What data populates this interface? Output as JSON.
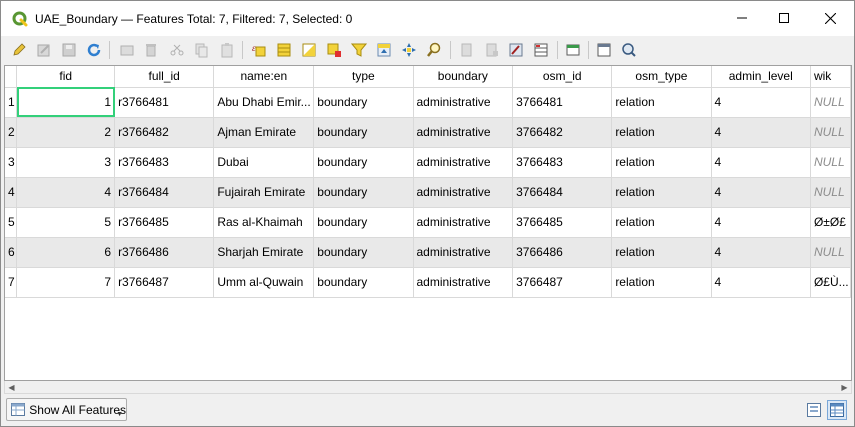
{
  "window": {
    "title": "UAE_Boundary — Features Total: 7, Filtered: 7, Selected: 0"
  },
  "toolbar_icons": [
    "toggle-editing-icon",
    "multi-edit-icon",
    "save-edits-icon",
    "reload-icon",
    "add-feature-icon",
    "delete-feature-icon",
    "cut-icon",
    "copy-icon",
    "paste-icon",
    "select-by-expression-icon",
    "select-all-icon",
    "invert-selection-icon",
    "deselect-all-icon",
    "filter-select-icon",
    "move-selection-top-icon",
    "pan-to-selection-icon",
    "zoom-to-selection-icon",
    "new-field-icon",
    "delete-field-icon",
    "open-field-calculator-icon",
    "conditional-formatting-icon",
    "dock-table-icon",
    "actions-icon",
    "zoom-map-icon"
  ],
  "table": {
    "columns": [
      "fid",
      "full_id",
      "name:en",
      "type",
      "boundary",
      "osm_id",
      "osm_type",
      "admin_level",
      "wik"
    ],
    "rows": [
      {
        "row": "1",
        "fid": "1",
        "full_id": "r3766481",
        "name_en": "Abu Dhabi Emir...",
        "type": "boundary",
        "boundary": "administrative",
        "osm_id": "3766481",
        "osm_type": "relation",
        "admin_level": "4",
        "wik": "NULL"
      },
      {
        "row": "2",
        "fid": "2",
        "full_id": "r3766482",
        "name_en": "Ajman Emirate",
        "type": "boundary",
        "boundary": "administrative",
        "osm_id": "3766482",
        "osm_type": "relation",
        "admin_level": "4",
        "wik": "NULL"
      },
      {
        "row": "3",
        "fid": "3",
        "full_id": "r3766483",
        "name_en": "Dubai",
        "type": "boundary",
        "boundary": "administrative",
        "osm_id": "3766483",
        "osm_type": "relation",
        "admin_level": "4",
        "wik": "NULL"
      },
      {
        "row": "4",
        "fid": "4",
        "full_id": "r3766484",
        "name_en": "Fujairah Emirate",
        "type": "boundary",
        "boundary": "administrative",
        "osm_id": "3766484",
        "osm_type": "relation",
        "admin_level": "4",
        "wik": "NULL"
      },
      {
        "row": "5",
        "fid": "5",
        "full_id": "r3766485",
        "name_en": "Ras al-Khaimah",
        "type": "boundary",
        "boundary": "administrative",
        "osm_id": "3766485",
        "osm_type": "relation",
        "admin_level": "4",
        "wik": "Ø±Ø£"
      },
      {
        "row": "6",
        "fid": "6",
        "full_id": "r3766486",
        "name_en": "Sharjah Emirate",
        "type": "boundary",
        "boundary": "administrative",
        "osm_id": "3766486",
        "osm_type": "relation",
        "admin_level": "4",
        "wik": "NULL"
      },
      {
        "row": "7",
        "fid": "7",
        "full_id": "r3766487",
        "name_en": "Umm al-Quwain",
        "type": "boundary",
        "boundary": "administrative",
        "osm_id": "3766487",
        "osm_type": "relation",
        "admin_level": "4",
        "wik": "Ø£Ù..."
      }
    ]
  },
  "bottom": {
    "show_features_label": "Show All Features"
  },
  "colors": {
    "selection_outline": "#33d07a",
    "alt_row": "#e9e9e9",
    "qgis_green": "#589632"
  }
}
